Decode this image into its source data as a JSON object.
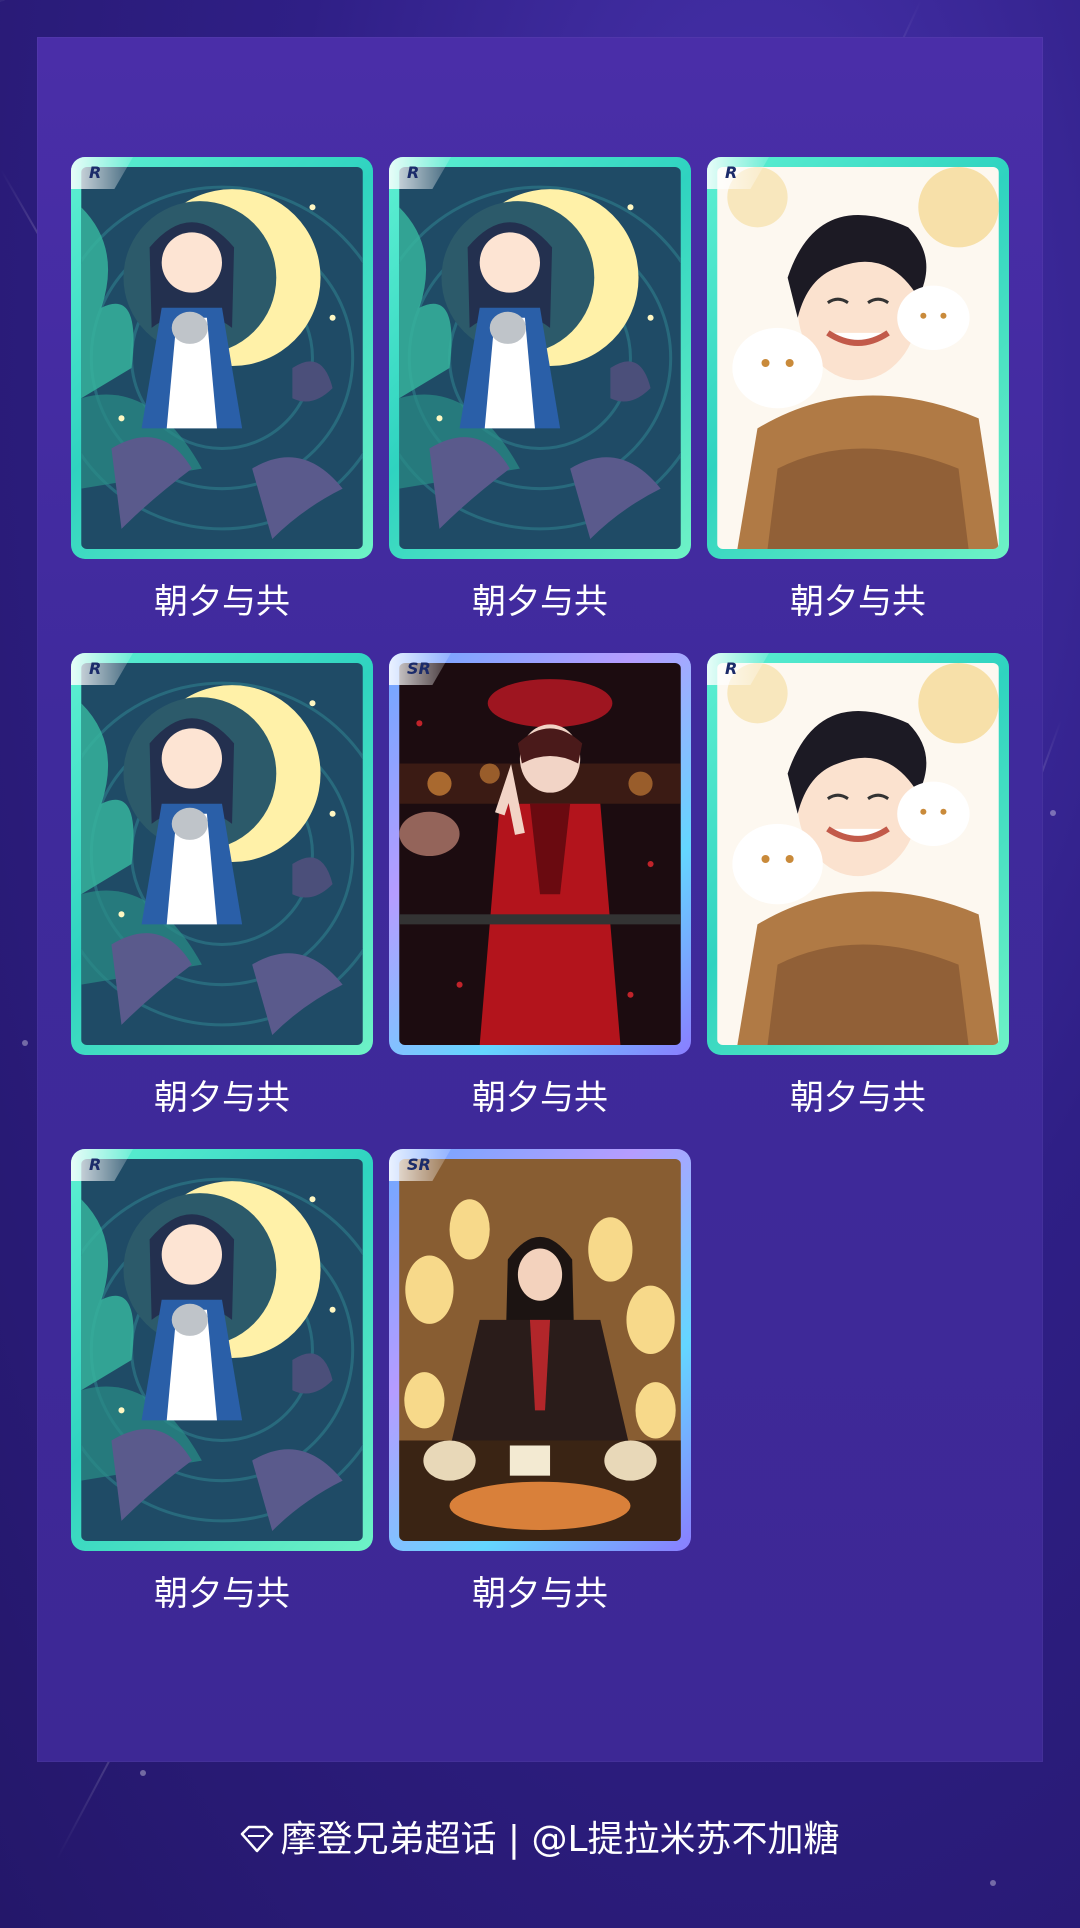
{
  "cards": [
    {
      "rarity": "R",
      "title": "朝夕与共",
      "art": "moon-chibi-art"
    },
    {
      "rarity": "R",
      "title": "朝夕与共",
      "art": "moon-chibi-art"
    },
    {
      "rarity": "R",
      "title": "朝夕与共",
      "art": "smiling-cats-art"
    },
    {
      "rarity": "R",
      "title": "朝夕与共",
      "art": "moon-chibi-art"
    },
    {
      "rarity": "SR",
      "title": "朝夕与共",
      "art": "red-suit-art"
    },
    {
      "rarity": "R",
      "title": "朝夕与共",
      "art": "smiling-cats-art"
    },
    {
      "rarity": "R",
      "title": "朝夕与共",
      "art": "moon-chibi-art"
    },
    {
      "rarity": "SR",
      "title": "朝夕与共",
      "art": "lantern-scholar-art"
    }
  ],
  "footer": {
    "text": "摩登兄弟超话 | @L提拉米苏不加糖",
    "icon": "diamond-icon"
  },
  "colors": {
    "background": "#2f1f86",
    "panel": "#4a2ea8",
    "frame_r": "#2fd3c0",
    "frame_sr": "#7aa8ff"
  }
}
